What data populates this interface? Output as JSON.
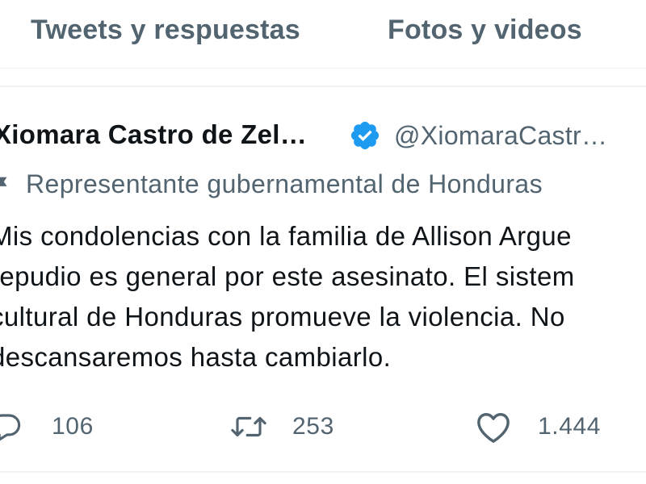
{
  "tabs": {
    "replies_label": "Tweets y respuestas",
    "media_label": "Fotos y videos"
  },
  "tweet": {
    "author_name": "Xiomara Castro de Zel…",
    "verified_icon": "verified-badge-icon",
    "handle": "@XiomaraCastr…",
    "government_label": "Representante gubernamental de Honduras",
    "text_lines": [
      "Mis condolencias con la familia de Allison Argue",
      "repudio es general por este asesinato. El sistem",
      "cultural de Honduras promueve la violencia. No",
      "descansaremos hasta cambiarlo."
    ],
    "actions": {
      "reply_icon": "reply-icon",
      "reply_count": "106",
      "retweet_icon": "retweet-icon",
      "retweet_count": "253",
      "like_icon": "heart-icon",
      "like_count": "1.444"
    }
  },
  "colors": {
    "primary_text": "#0f1419",
    "secondary_text": "#536471",
    "verified_blue": "#1d9bf0",
    "divider": "#eff3f4"
  }
}
